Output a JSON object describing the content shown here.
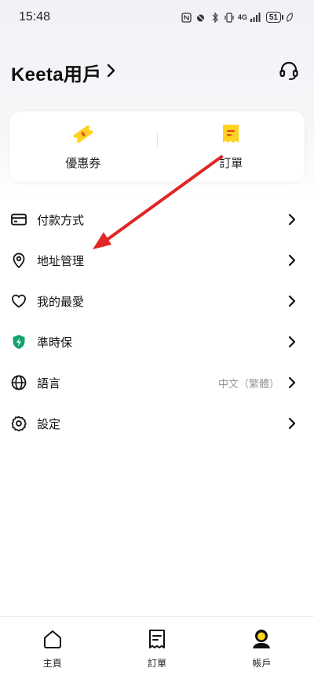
{
  "status_bar": {
    "time": "15:48",
    "network": "4G",
    "battery": "51"
  },
  "header": {
    "user_name": "Keeta用戶",
    "icons": {
      "chevron": "chevron-right-icon",
      "support": "headset-icon"
    }
  },
  "shortcuts": [
    {
      "label": "優惠券",
      "icon": "coupon-icon"
    },
    {
      "label": "訂單",
      "icon": "receipt-icon"
    }
  ],
  "menu": [
    {
      "label": "付款方式",
      "icon": "credit-card-icon",
      "value": ""
    },
    {
      "label": "地址管理",
      "icon": "location-pin-icon",
      "value": ""
    },
    {
      "label": "我的最愛",
      "icon": "heart-icon",
      "value": ""
    },
    {
      "label": "準時保",
      "icon": "shield-bolt-icon",
      "value": ""
    },
    {
      "label": "語言",
      "icon": "globe-icon",
      "value": "中文（繁體）"
    },
    {
      "label": "設定",
      "icon": "gear-icon",
      "value": ""
    }
  ],
  "bottom_nav": [
    {
      "label": "主頁",
      "icon": "home-icon"
    },
    {
      "label": "訂單",
      "icon": "receipt-icon"
    },
    {
      "label": "帳戶",
      "icon": "account-icon"
    }
  ],
  "colors": {
    "brand_yellow": "#FFD21F",
    "coupon_red": "#E8412E",
    "shield_green": "#14A36D",
    "annotation_red": "#E02626"
  }
}
